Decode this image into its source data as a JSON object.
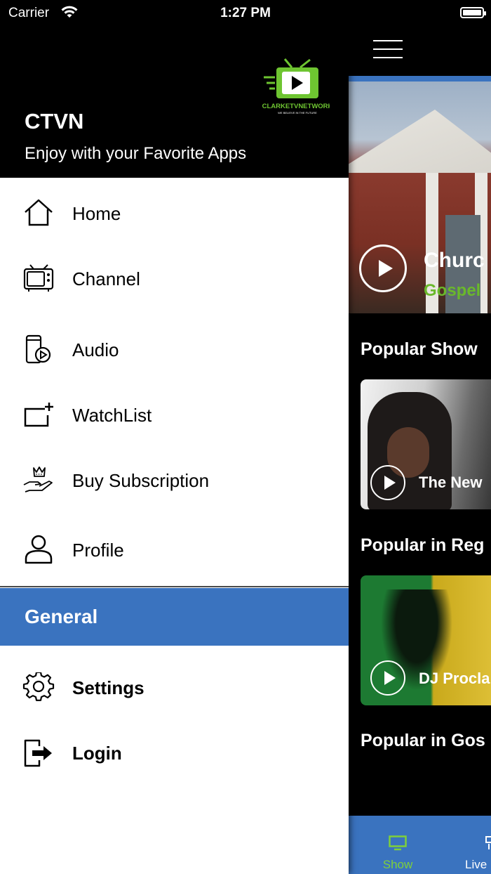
{
  "status_bar": {
    "carrier": "Carrier",
    "time": "1:27 PM"
  },
  "drawer": {
    "app_name": "CTVN",
    "tagline": "Enjoy with your Favorite Apps",
    "logo": {
      "brand": "CLARKETVNETWORK",
      "slogan": "WE BELIEVE IN THE FUTURE",
      "colors": {
        "green": "#6ec531",
        "white": "#ffffff"
      }
    },
    "menu": [
      {
        "label": "Home",
        "icon": "home-icon"
      },
      {
        "label": "Channel",
        "icon": "tv-icon"
      },
      {
        "label": "Audio",
        "icon": "audio-device-icon"
      },
      {
        "label": "WatchList",
        "icon": "watchlist-add-icon"
      },
      {
        "label": "Buy Subscription",
        "icon": "crown-hand-icon"
      },
      {
        "label": "Profile",
        "icon": "user-icon"
      }
    ],
    "section_header": "General",
    "general_items": [
      {
        "label": "Settings",
        "icon": "gear-icon"
      },
      {
        "label": "Login",
        "icon": "login-icon"
      }
    ]
  },
  "main": {
    "hero": {
      "title": "Churc",
      "genre": "Gospel"
    },
    "sections": [
      {
        "title": "Popular Show",
        "card_label": "The New"
      },
      {
        "title": "Popular in Reg",
        "card_label": "DJ Procla"
      },
      {
        "title": "Popular in Gos"
      }
    ],
    "tabs": [
      {
        "label": "Show",
        "active": true
      },
      {
        "label": "Live",
        "active": false
      }
    ]
  },
  "colors": {
    "accent_blue": "#3a73bf",
    "active_green": "#7ed03b",
    "genre_green": "#6ab82b"
  }
}
